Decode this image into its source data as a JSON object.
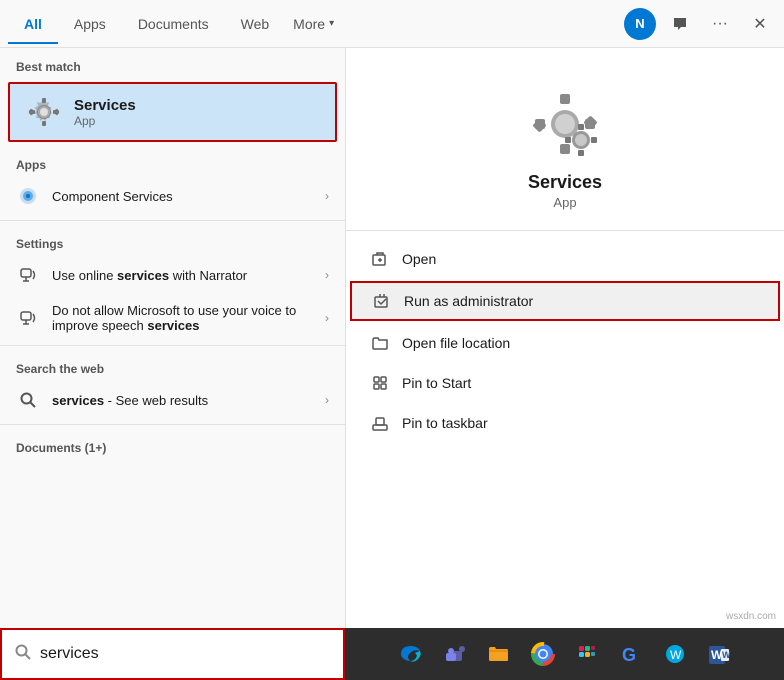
{
  "tabs": {
    "items": [
      {
        "label": "All",
        "active": true
      },
      {
        "label": "Apps",
        "active": false
      },
      {
        "label": "Documents",
        "active": false
      },
      {
        "label": "Web",
        "active": false
      },
      {
        "label": "More",
        "active": false
      }
    ]
  },
  "avatar": {
    "initials": "N"
  },
  "left_panel": {
    "best_match_label": "Best match",
    "best_match": {
      "title": "Services",
      "subtitle": "App"
    },
    "apps_label": "Apps",
    "apps_items": [
      {
        "label": "Component Services"
      }
    ],
    "settings_label": "Settings",
    "settings_items": [
      {
        "label_before": "Use online ",
        "keyword": "services",
        "label_after": " with Narrator"
      },
      {
        "label_before": "Do not allow Microsoft to use your voice to improve speech ",
        "keyword": "services",
        "label_after": ""
      }
    ],
    "web_label": "Search the web",
    "web_items": [
      {
        "label_before": "services",
        "label_after": " - See web results"
      }
    ],
    "docs_label": "Documents (1+)"
  },
  "right_panel": {
    "title": "Services",
    "subtitle": "App",
    "actions": [
      {
        "label": "Open",
        "icon": "open-icon"
      },
      {
        "label": "Run as administrator",
        "icon": "run-admin-icon",
        "highlighted": true
      },
      {
        "label": "Open file location",
        "icon": "folder-icon"
      },
      {
        "label": "Pin to Start",
        "icon": "pin-start-icon"
      },
      {
        "label": "Pin to taskbar",
        "icon": "pin-taskbar-icon"
      }
    ]
  },
  "search_bar": {
    "placeholder": "services",
    "value": "services"
  },
  "taskbar": {
    "icons": [
      "🌐",
      "💬",
      "📁",
      "🔵",
      "🟡",
      "🟢",
      "📧",
      "⌨️"
    ]
  },
  "watermark": "wsxdn.com"
}
